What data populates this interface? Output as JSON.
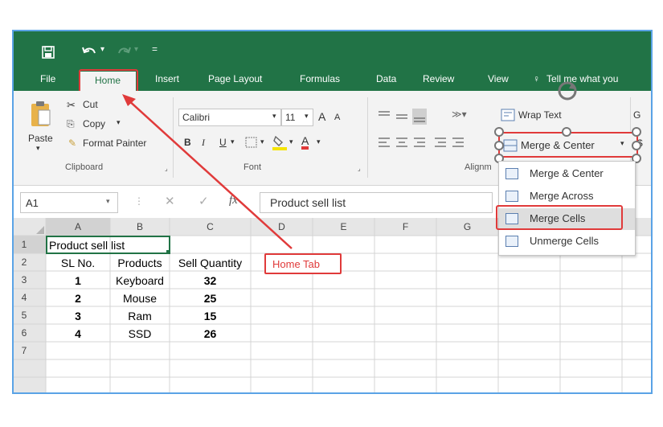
{
  "tabs": [
    "File",
    "Home",
    "Insert",
    "Page Layout",
    "Formulas",
    "Data",
    "Review",
    "View"
  ],
  "tell_me": "Tell me what you",
  "clipboard": {
    "paste": "Paste",
    "cut": "Cut",
    "copy": "Copy",
    "format_painter": "Format Painter",
    "group_label": "Clipboard"
  },
  "font": {
    "name": "Calibri",
    "size": "11",
    "bold": "B",
    "italic": "I",
    "underline": "U",
    "group_label": "Font",
    "grow": "A",
    "shrink": "A",
    "font_color": "A"
  },
  "alignment": {
    "group_label": "Alignm",
    "wrap_text": "Wrap Text",
    "merge_center": "Merge & Center"
  },
  "next_group_partial": "G",
  "name_box": "A1",
  "formula_content": "Product sell list",
  "fx": "fx",
  "columns": [
    "A",
    "B",
    "C",
    "D",
    "E",
    "F",
    "G"
  ],
  "rows": [
    "1",
    "2",
    "3",
    "4",
    "5",
    "6",
    "7"
  ],
  "cells": {
    "a1": "Product sell list",
    "headers": [
      "SL No.",
      "Products",
      "Sell Quantity"
    ],
    "data": [
      [
        "1",
        "Keyboard",
        "32"
      ],
      [
        "2",
        "Mouse",
        "25"
      ],
      [
        "3",
        "Ram",
        "15"
      ],
      [
        "4",
        "SSD",
        "26"
      ]
    ]
  },
  "merge_menu": [
    "Merge & Center",
    "Merge Across",
    "Merge Cells",
    "Unmerge Cells"
  ],
  "annotation": "Home Tab",
  "colors": {
    "excel_green": "#217346",
    "annotation_red": "#e03a3a",
    "frame_blue": "#5aa3e6"
  }
}
